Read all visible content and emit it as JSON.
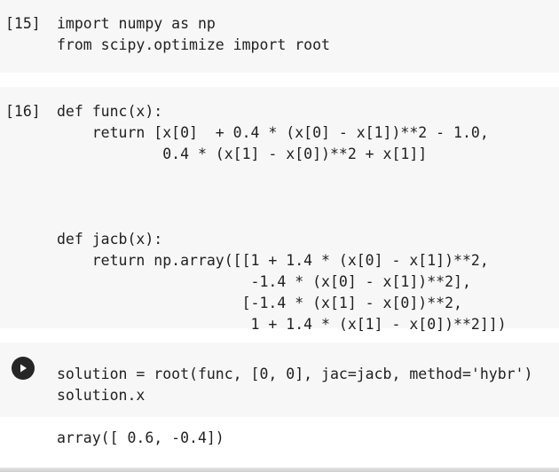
{
  "cells": [
    {
      "prompt": "[15]",
      "lines": [
        "import numpy as np",
        "from scipy.optimize import root"
      ]
    },
    {
      "prompt": "[16]",
      "lines": [
        "def func(x):",
        "    return [x[0]  + 0.4 * (x[0] - x[1])**2 - 1.0,",
        "            0.4 * (x[1] - x[0])**2 + x[1]]",
        "",
        "",
        "",
        "def jacb(x):",
        "    return np.array([[1 + 1.4 * (x[0] - x[1])**2,",
        "                      -1.4 * (x[0] - x[1])**2],",
        "                     [-1.4 * (x[1] - x[0])**2,",
        "                      1 + 1.4 * (x[1] - x[0])**2]])"
      ]
    },
    {
      "run_icon": "play-icon",
      "lines": [
        "solution = root(func, [0, 0], jac=jacb, method='hybr')",
        "solution.x"
      ]
    }
  ],
  "output": "array([ 0.6, -0.4])"
}
